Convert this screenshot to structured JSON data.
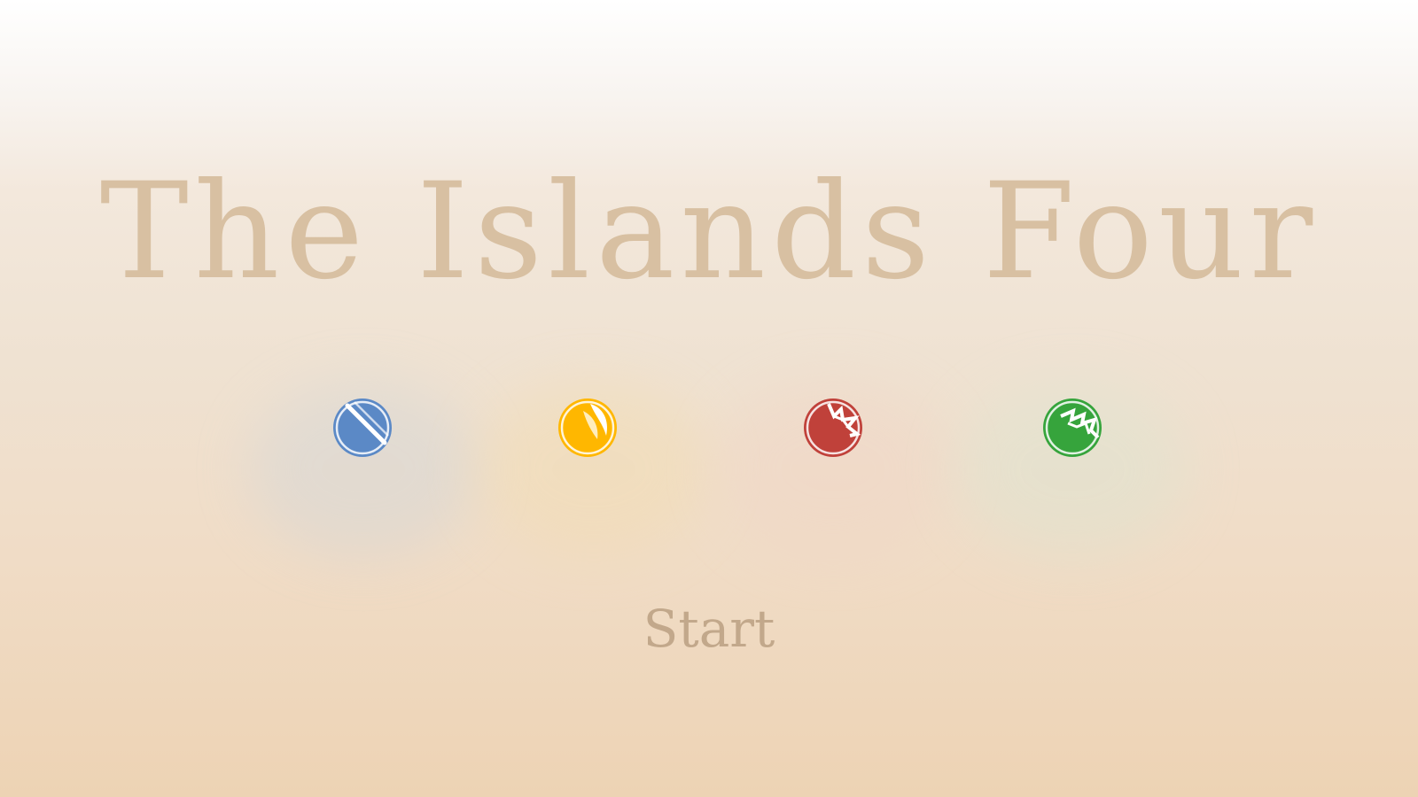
{
  "title": "The Islands Four",
  "start_label": "Start",
  "colors": {
    "title": "#d8c0a2",
    "start": "#c2a88b",
    "island_blue": "#5b89c6",
    "island_yellow": "#ffb700",
    "island_red": "#c0413a",
    "island_green": "#36a43c"
  },
  "islands": [
    {
      "icon": "blue-island-icon"
    },
    {
      "icon": "yellow-island-icon"
    },
    {
      "icon": "red-island-icon"
    },
    {
      "icon": "green-island-icon"
    }
  ]
}
